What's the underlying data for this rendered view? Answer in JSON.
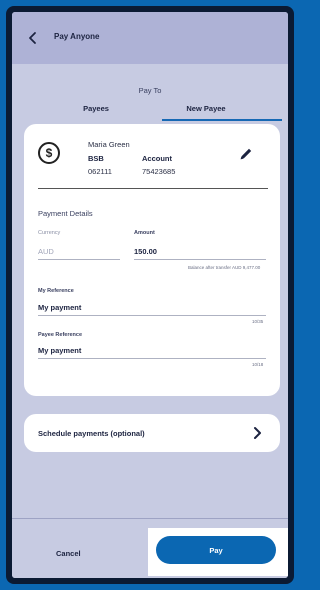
{
  "header": {
    "title": "Pay Anyone",
    "back_icon": "chevron-left-icon"
  },
  "pay_to": {
    "label": "Pay To",
    "tabs": [
      {
        "label": "Payees",
        "active": false
      },
      {
        "label": "New Payee",
        "active": true
      }
    ]
  },
  "payee": {
    "icon": "dollar-circle-icon",
    "name": "Maria Green",
    "bsb_label": "BSB",
    "bsb": "062111",
    "account_label": "Account",
    "account": "75423685",
    "edit_icon": "pencil-icon"
  },
  "payment_details": {
    "title": "Payment Details",
    "currency_label": "Currency",
    "currency_value": "AUD",
    "amount_label": "Amount",
    "amount_value": "150.00",
    "balance_note": "Balance after transfer AUD 9,477.00",
    "my_reference_label": "My Reference",
    "my_reference_value": "My payment",
    "my_reference_count": "10/35",
    "payee_reference_label": "Payee Reference",
    "payee_reference_value": "My payment",
    "payee_reference_count": "10/18"
  },
  "schedule": {
    "label": "Schedule payments (optional)",
    "icon": "chevron-right-icon"
  },
  "actions": {
    "cancel": "Cancel",
    "pay": "Pay"
  },
  "colors": {
    "accent": "#0b67b2",
    "background": "#c7cbe2",
    "header": "#aeb2d6"
  }
}
